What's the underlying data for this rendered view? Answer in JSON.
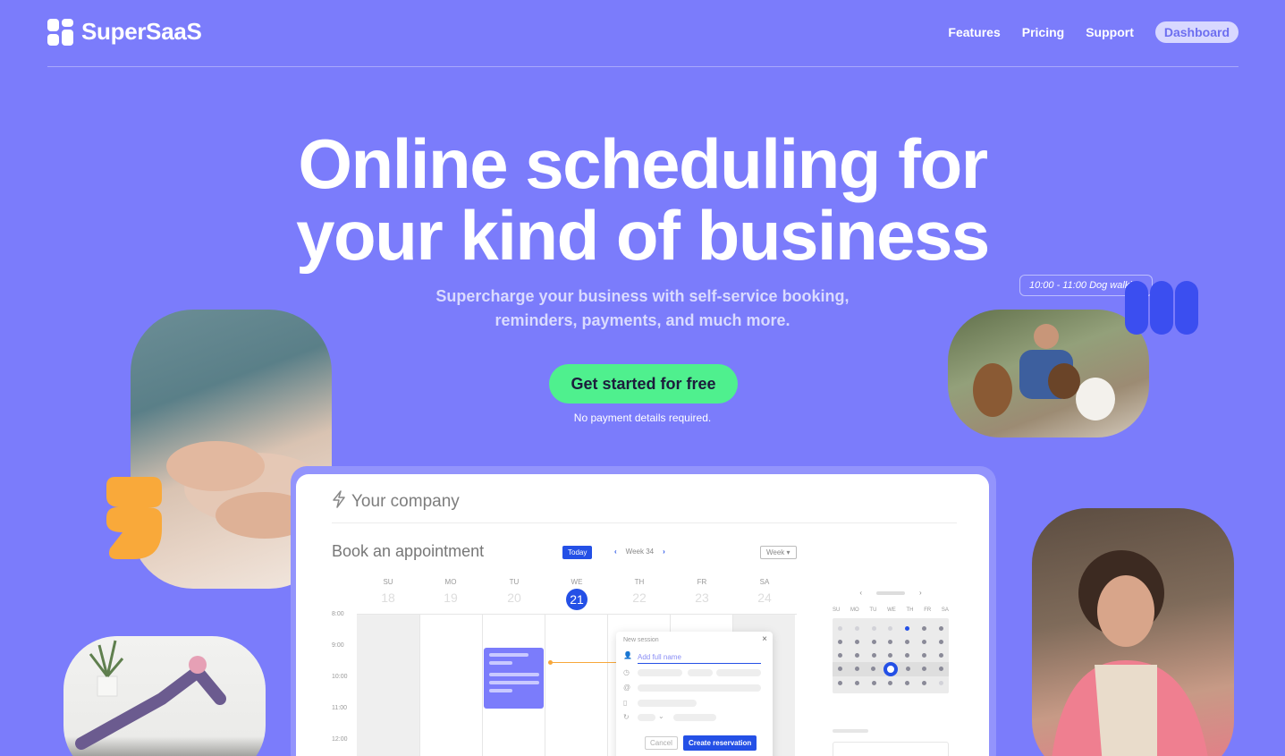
{
  "brand": {
    "name": "SuperSaaS"
  },
  "nav": {
    "features": "Features",
    "pricing": "Pricing",
    "support": "Support",
    "dashboard": "Dashboard"
  },
  "hero": {
    "title_line1": "Online scheduling for",
    "title_line2": "your kind of business",
    "subtitle_line1": "Supercharge your business with self-service booking,",
    "subtitle_line2": "reminders, payments, and much more.",
    "cta": "Get started for free",
    "cta_note": "No payment details required."
  },
  "dog_tag": "10:00 - 11:00  Dog walking",
  "colors": {
    "background": "#7b7cfb",
    "cta": "#4ff08e",
    "accent_blue": "#2450e6",
    "accent_orange": "#f7a73a"
  },
  "app": {
    "company": "Your company",
    "book_title": "Book an appointment",
    "today": "Today",
    "week_label": "Week 34",
    "view_select": "Week",
    "days": [
      {
        "abbr": "SU",
        "num": "18"
      },
      {
        "abbr": "MO",
        "num": "19"
      },
      {
        "abbr": "TU",
        "num": "20"
      },
      {
        "abbr": "WE",
        "num": "21"
      },
      {
        "abbr": "TH",
        "num": "22"
      },
      {
        "abbr": "FR",
        "num": "23"
      },
      {
        "abbr": "SA",
        "num": "24"
      }
    ],
    "times": [
      "8:00",
      "9:00",
      "10:00",
      "11:00",
      "12:00"
    ],
    "session": {
      "title": "New session",
      "name_placeholder": "Add full name",
      "cancel": "Cancel",
      "create": "Create reservation"
    },
    "mini_days": [
      "SU",
      "MO",
      "TU",
      "WE",
      "TH",
      "FR",
      "SA"
    ]
  }
}
